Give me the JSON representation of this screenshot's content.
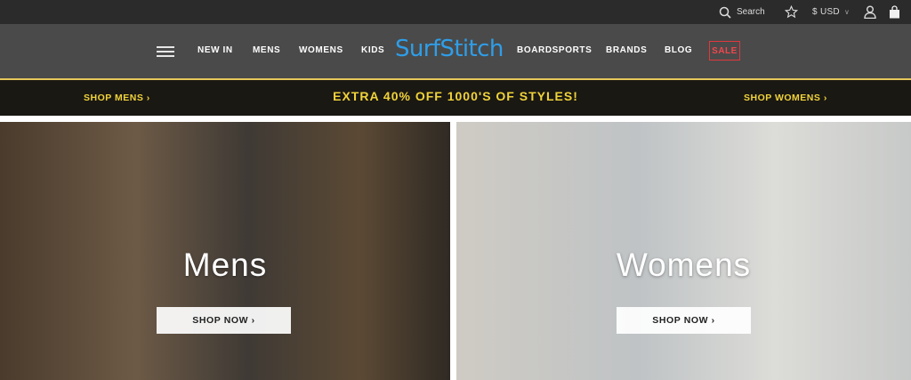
{
  "topbar": {
    "search_label": "Search",
    "currency": "$ USD",
    "currency_chevron": "∨"
  },
  "nav": {
    "left_links": [
      "NEW IN",
      "MENS",
      "WOMENS",
      "KIDS"
    ],
    "logo": "SurfStitch",
    "right_links": [
      "BOARDSPORTS",
      "BRANDS",
      "BLOG"
    ],
    "sale": "SALE"
  },
  "promo": {
    "left": "SHOP MENS ›",
    "center": "EXTRA 40% OFF 1000'S OF STYLES!",
    "right": "SHOP WOMENS ›"
  },
  "hero": {
    "mens": {
      "title": "Mens",
      "button": "SHOP NOW ›"
    },
    "womens": {
      "title": "Womens",
      "button": "SHOP NOW ›"
    }
  },
  "colors": {
    "topbar_bg": "#2b2b2b",
    "nav_bg": "#4a4a4a",
    "logo": "#2f9ee8",
    "promo_bg": "#1a1813",
    "promo_text": "#f0d33a",
    "sale": "#f0474d"
  },
  "icons": [
    "search-icon",
    "star-icon",
    "user-icon",
    "shopping-bag-icon",
    "menu-icon"
  ]
}
